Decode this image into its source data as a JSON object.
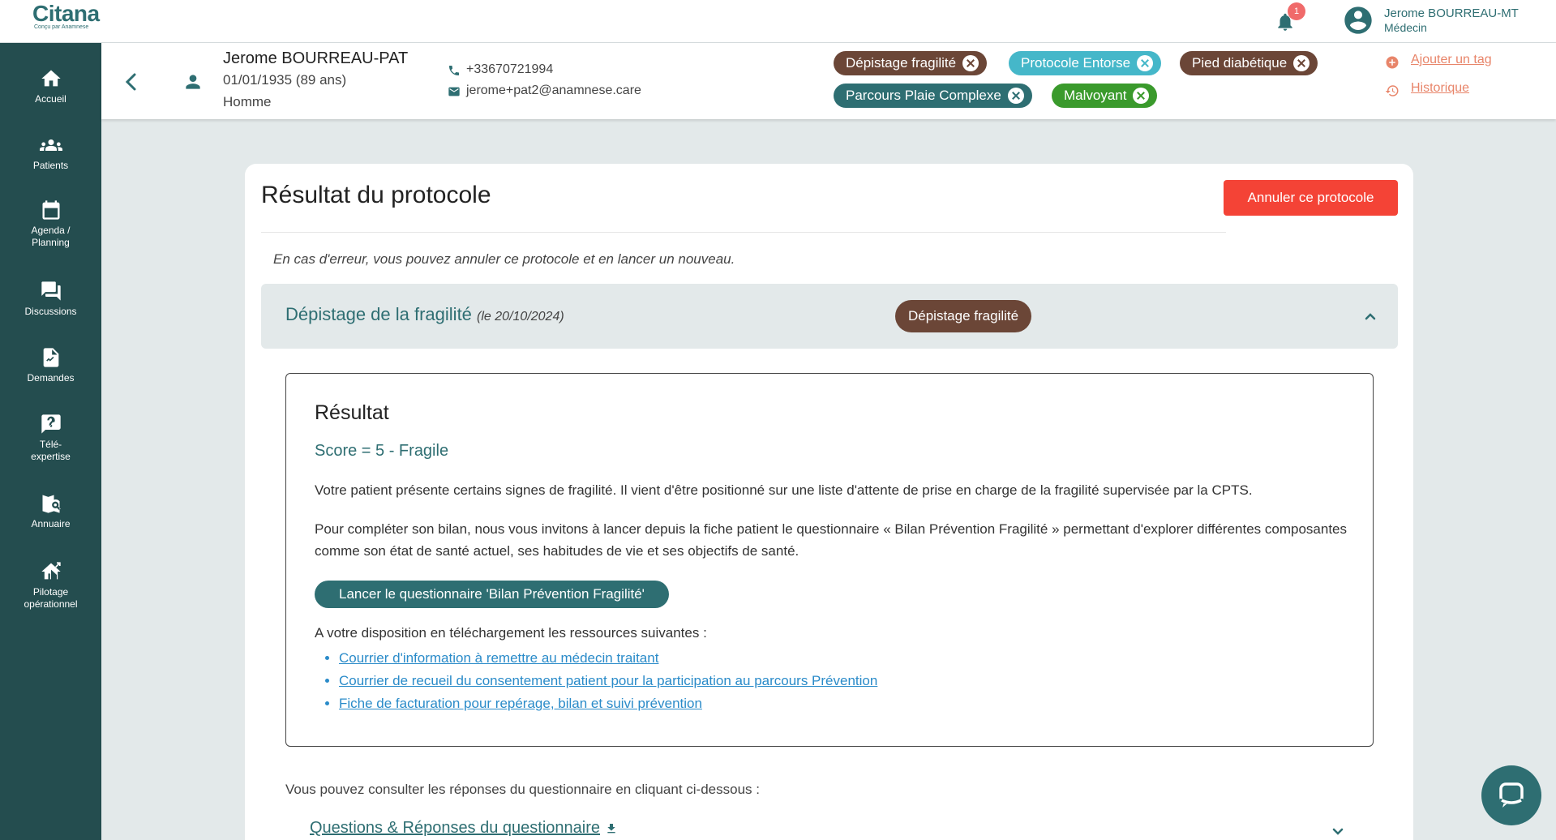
{
  "app": {
    "brand": "Citana",
    "brand_sub": "Conçu par Anamnese"
  },
  "topbar": {
    "notification_count": "1",
    "user_name": "Jerome BOURREAU-MT",
    "user_role": "Médecin"
  },
  "sidebar": {
    "items": [
      {
        "label": "Accueil",
        "icon": "home-icon"
      },
      {
        "label": "Patients",
        "icon": "people-icon"
      },
      {
        "label": "Agenda / Planning",
        "icon": "calendar-icon"
      },
      {
        "label": "Discussions",
        "icon": "chat-icon"
      },
      {
        "label": "Demandes",
        "icon": "document-icon"
      },
      {
        "label": "Télé-expertise",
        "icon": "question-icon"
      },
      {
        "label": "Annuaire",
        "icon": "map-search-icon"
      },
      {
        "label": "Pilotage opérationnel",
        "icon": "home-chart-icon"
      }
    ]
  },
  "patient": {
    "name": "Jerome BOURREAU-PAT",
    "dob": "01/01/1935 (89 ans)",
    "sex": "Homme",
    "phone": "+33670721994",
    "email": "jerome+pat2@anamnese.care"
  },
  "tags": [
    {
      "label": "Dépistage fragilité",
      "color": "#6b4637"
    },
    {
      "label": "Protocole Entorse",
      "color": "#45b7c9"
    },
    {
      "label": "Pied diabétique",
      "color": "#6b4637"
    },
    {
      "label": "Parcours Plaie Complexe",
      "color": "#2e6e72"
    },
    {
      "label": "Malvoyant",
      "color": "#3a9a2c"
    }
  ],
  "actions": {
    "add_tag": "Ajouter un tag",
    "history": "Historique"
  },
  "card": {
    "title": "Résultat du protocole",
    "cancel_button": "Annuler ce protocole",
    "note": "En cas d'erreur, vous pouvez annuler ce protocole et en lancer un nouveau.",
    "accordion": {
      "title": "Dépistage de la fragilité",
      "date": "(le 20/10/2024)",
      "badge": "Dépistage fragilité"
    },
    "result": {
      "title": "Résultat",
      "score": "Score = 5 - Fragile",
      "p1": "Votre patient présente certains signes de fragilité. Il vient d'être positionné sur une liste d'attente de prise en charge de la fragilité supervisée par la CPTS.",
      "p2": "Pour compléter son bilan, nous vous invitons à lancer depuis la fiche patient le questionnaire « Bilan Prévention Fragilité » permettant d'explorer différentes composantes comme son état de santé actuel, ses habitudes de vie et ses objectifs de santé.",
      "launch_button": "Lancer le questionnaire 'Bilan Prévention Fragilité'",
      "downloads_intro": "A votre disposition en téléchargement les ressources suivantes :",
      "links": [
        "Courrier d'information à remettre au médecin traitant",
        "Courrier de recueil du consentement patient pour la participation au parcours Prévention",
        "Fiche de facturation pour repérage, bilan et suivi prévention"
      ]
    },
    "consult_text": "Vous pouvez consulter les réponses du questionnaire en cliquant ci-dessous :",
    "qa_link": "Questions & Réponses du questionnaire"
  },
  "colors": {
    "primary": "#2e6e72",
    "sidebar": "#244d4f",
    "danger": "#f44336",
    "link": "#2a8bc9",
    "accent": "#e8856a"
  }
}
